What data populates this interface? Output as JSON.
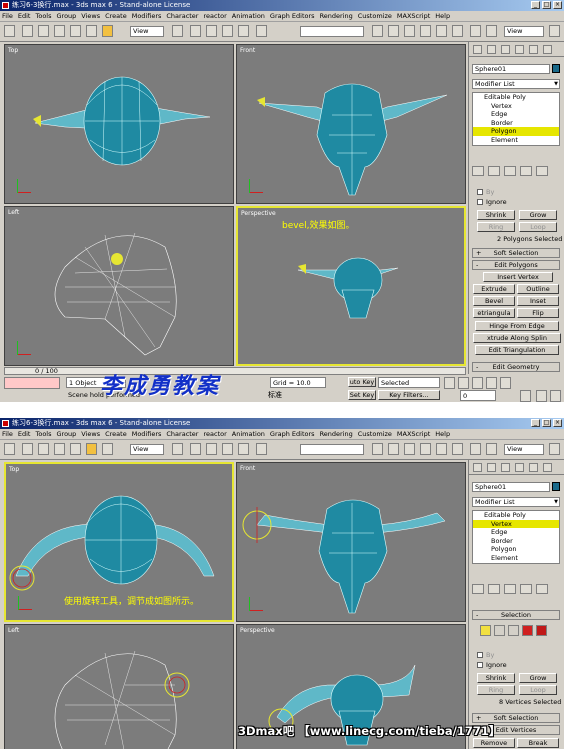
{
  "top": {
    "title": "练习6-3换行.max - 3ds max 6 - Stand-alone License",
    "menu": [
      "File",
      "Edit",
      "Tools",
      "Group",
      "Views",
      "Create",
      "Modifiers",
      "Character",
      "reactor",
      "Animation",
      "Graph Editors",
      "Rendering",
      "Customize",
      "MAXScript",
      "Help"
    ],
    "view_dropdown": "View",
    "panel_view_dropdown": "View",
    "viewports": {
      "top": "Top",
      "front": "Front",
      "left": "Left",
      "perspective": "Perspective"
    },
    "perspective_note": "bevel,效果如图。",
    "object_name": "Sphere01",
    "modifier_list": "Modifier List",
    "stack": {
      "root": "Editable Poly",
      "items": [
        "Vertex",
        "Edge",
        "Border",
        "Polygon",
        "Element"
      ],
      "selected": "Polygon"
    },
    "by_label": "By",
    "ignore_label": "Ignore",
    "shrink": "Shrink",
    "grow": "Grow",
    "ring": "Ring",
    "loop": "Loop",
    "selected_info": "2 Polygons Selected",
    "soft_selection": "Soft Selection",
    "edit_polygons": "Edit Polygons",
    "insert_vertex": "Insert Vertex",
    "extrude": "Extrude",
    "outline": "Outline",
    "bevel": "Bevel",
    "inset": "Inset",
    "retriangulate": "etriangula",
    "flip": "Flip",
    "hinge": "Hinge From Edge",
    "extrude_spline": "xtrude Along Splin",
    "edit_tri": "Edit Triangulation",
    "edit_geometry": "Edit Geometry",
    "timeline": "0 / 100",
    "object_count": "1 Object",
    "scene_msg": "Scene hold performed",
    "grid": "Grid = 10.0",
    "auto_key": "uto Key",
    "set_key": "Set Key",
    "selected_dd": "Selected",
    "key_filters": "Key Filters...",
    "frame": "0",
    "watermark": "李成勇教案",
    "unit_tag": "标准"
  },
  "bottom": {
    "title": "练习6-3换行.max - 3ds max 6 - Stand-alone License",
    "menu": [
      "File",
      "Edit",
      "Tools",
      "Group",
      "Views",
      "Create",
      "Modifiers",
      "Character",
      "reactor",
      "Animation",
      "Graph Editors",
      "Rendering",
      "Customize",
      "MAXScript",
      "Help"
    ],
    "view_dropdown": "View",
    "panel_view_dropdown": "View",
    "viewports": {
      "top": "Top",
      "front": "Front",
      "left": "Left",
      "perspective": "Perspective"
    },
    "top_note": "使用旋转工具，调节成如图所示。",
    "object_name": "Sphere01",
    "modifier_list": "Modifier List",
    "stack": {
      "root": "Editable Poly",
      "items": [
        "Vertex",
        "Edge",
        "Border",
        "Polygon",
        "Element"
      ],
      "selected": "Vertex"
    },
    "selection": "Selection",
    "by_label": "By",
    "ignore_label": "Ignore",
    "shrink": "Shrink",
    "grow": "Grow",
    "ring": "Ring",
    "loop": "Loop",
    "selected_info": "8 Vertices Selected",
    "soft_selection": "Soft Selection",
    "edit_vertices": "Edit Vertices",
    "remove": "Remove",
    "break": "Break"
  },
  "footer_watermark": "3Dmax吧 【www.linecg.com/tieba/1771】",
  "colors": {
    "viewport_bg": "#7c7c7c",
    "active_border": "#e6e632",
    "mesh": "#2a8fa8",
    "note": "#ffff00",
    "watermark_blue": "#1230c8",
    "selection_yellow": "#e6e600"
  }
}
